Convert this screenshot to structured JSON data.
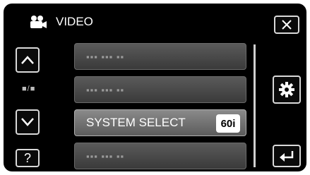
{
  "header": {
    "icon": "video-camera-icon",
    "title": "VIDEO"
  },
  "buttons": {
    "close_icon": "close-x-icon",
    "up_icon": "chevron-up-icon",
    "down_icon": "chevron-down-icon",
    "help_label": "?",
    "settings_icon": "gear-icon",
    "back_icon": "return-arrow-icon"
  },
  "pager": {
    "text": "■/■"
  },
  "menu": {
    "items": [
      {
        "label": "▪▪▪ ▪▪▪ ▪▪",
        "enabled": false
      },
      {
        "label": "▪▪▪ ▪▪▪ ▪▪",
        "enabled": false
      },
      {
        "label": "SYSTEM SELECT",
        "value": "60i",
        "enabled": true
      },
      {
        "label": "▪▪▪ ▪▪▪ ▪▪",
        "enabled": false
      }
    ]
  },
  "colors": {
    "background": "#000000",
    "item": "#4a4a4a",
    "item_active": "#7a7a7a",
    "badge": "#ffffff"
  }
}
